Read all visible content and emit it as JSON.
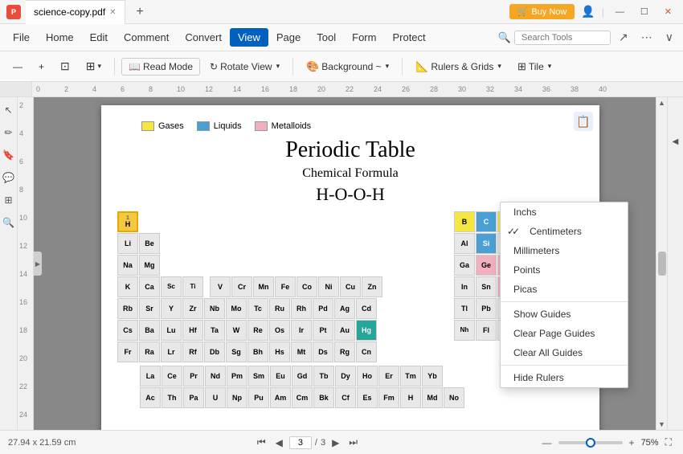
{
  "titleBar": {
    "appIcon": "P",
    "tabName": "science-copy.pdf",
    "buyNow": "Buy Now",
    "winClose": "✕",
    "winMin": "—",
    "winMax": "☐"
  },
  "menuBar": {
    "items": [
      "File",
      "Home",
      "Edit",
      "Comment",
      "Convert",
      "View",
      "Page",
      "Tool",
      "Form",
      "Protect"
    ],
    "activeItem": "View",
    "searchPlaceholder": "Search Tools"
  },
  "toolbar": {
    "zoomOut": "—",
    "zoomIn": "+",
    "fitPage": "",
    "readMode": "Read Mode",
    "rotateView": "Rotate View",
    "background": "Background ~",
    "rulersGrids": "Rulers & Grids",
    "tile": "Tile"
  },
  "dropdownMenu": {
    "items": [
      {
        "label": "Inchs",
        "checked": false
      },
      {
        "label": "Centimeters",
        "checked": true
      },
      {
        "label": "Millimeters",
        "checked": false
      },
      {
        "label": "Points",
        "checked": false
      },
      {
        "label": "Picas",
        "checked": false
      }
    ],
    "separator": true,
    "secondItems": [
      {
        "label": "Show Guides",
        "checked": false
      },
      {
        "label": "Clear Page Guides",
        "checked": false
      },
      {
        "label": "Clear All Guides",
        "checked": false
      }
    ],
    "separator2": true,
    "thirdItems": [
      {
        "label": "Hide Rulers",
        "checked": false
      }
    ]
  },
  "periodicTable": {
    "title": "Periodic Table",
    "subtitle": "Chemical Formula",
    "formula": "H-O-O-H",
    "legendGases": "Gases",
    "legendLiquids": "Liquids",
    "legendMetalloids": "Metalloids"
  },
  "statusBar": {
    "dimensions": "27.94 x 21.59 cm",
    "currentPage": "3",
    "totalPages": "3",
    "zoomPercent": "75%"
  },
  "colors": {
    "accent": "#0060c0",
    "activeMenu": "#0060c0",
    "dropdownBg": "#ffffff",
    "elementYellow": "#f5e642",
    "elementBlue": "#4a9fd4",
    "elementPink": "#f0b0c0"
  }
}
